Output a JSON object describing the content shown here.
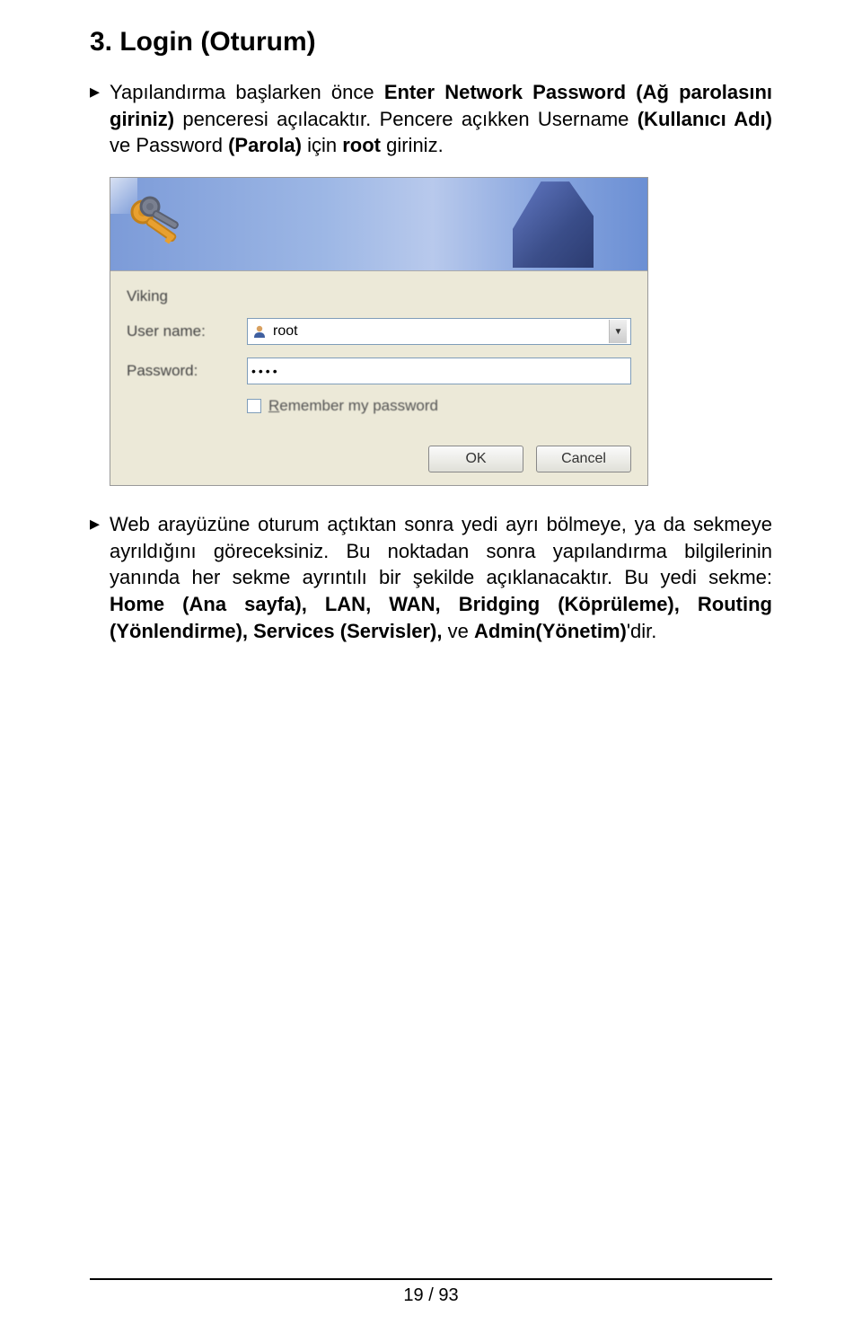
{
  "heading": "3.  Login (Oturum)",
  "para1_pre": "Yapılandırma başlarken önce ",
  "para1_bold1": "Enter Network Password (Ağ parolasını giriniz)",
  "para1_mid1": " penceresi açılacaktır. Pencere açıkken Username ",
  "para1_bold2": "(Kullanıcı Adı)",
  "para1_mid2": " ve Password ",
  "para1_bold3": "(Parola)",
  "para1_mid3": " için ",
  "para1_bold4": "root",
  "para1_end": " giriniz.",
  "dialog": {
    "realm": "Viking",
    "user_label": "User name:",
    "pass_label": "Password:",
    "user_value": "root",
    "pass_value": "••••",
    "remember": "Remember my password",
    "ok": "OK",
    "cancel": "Cancel"
  },
  "para2_pre": "Web arayüzüne oturum açtıktan sonra yedi ayrı bölmeye, ya da sekmeye ayrıldığını göreceksiniz. Bu noktadan sonra yapılandırma bilgilerinin yanında her sekme ayrıntılı bir şekilde açıklanacaktır. Bu yedi sekme: ",
  "para2_bold": "Home (Ana sayfa), LAN, WAN, Bridging (Köprüleme), Routing (Yönlendirme), Services (Servisler),",
  "para2_mid": " ve ",
  "para2_bold2": "Admin(Yönetim)",
  "para2_end": "'dir.",
  "page": "19 / 93"
}
